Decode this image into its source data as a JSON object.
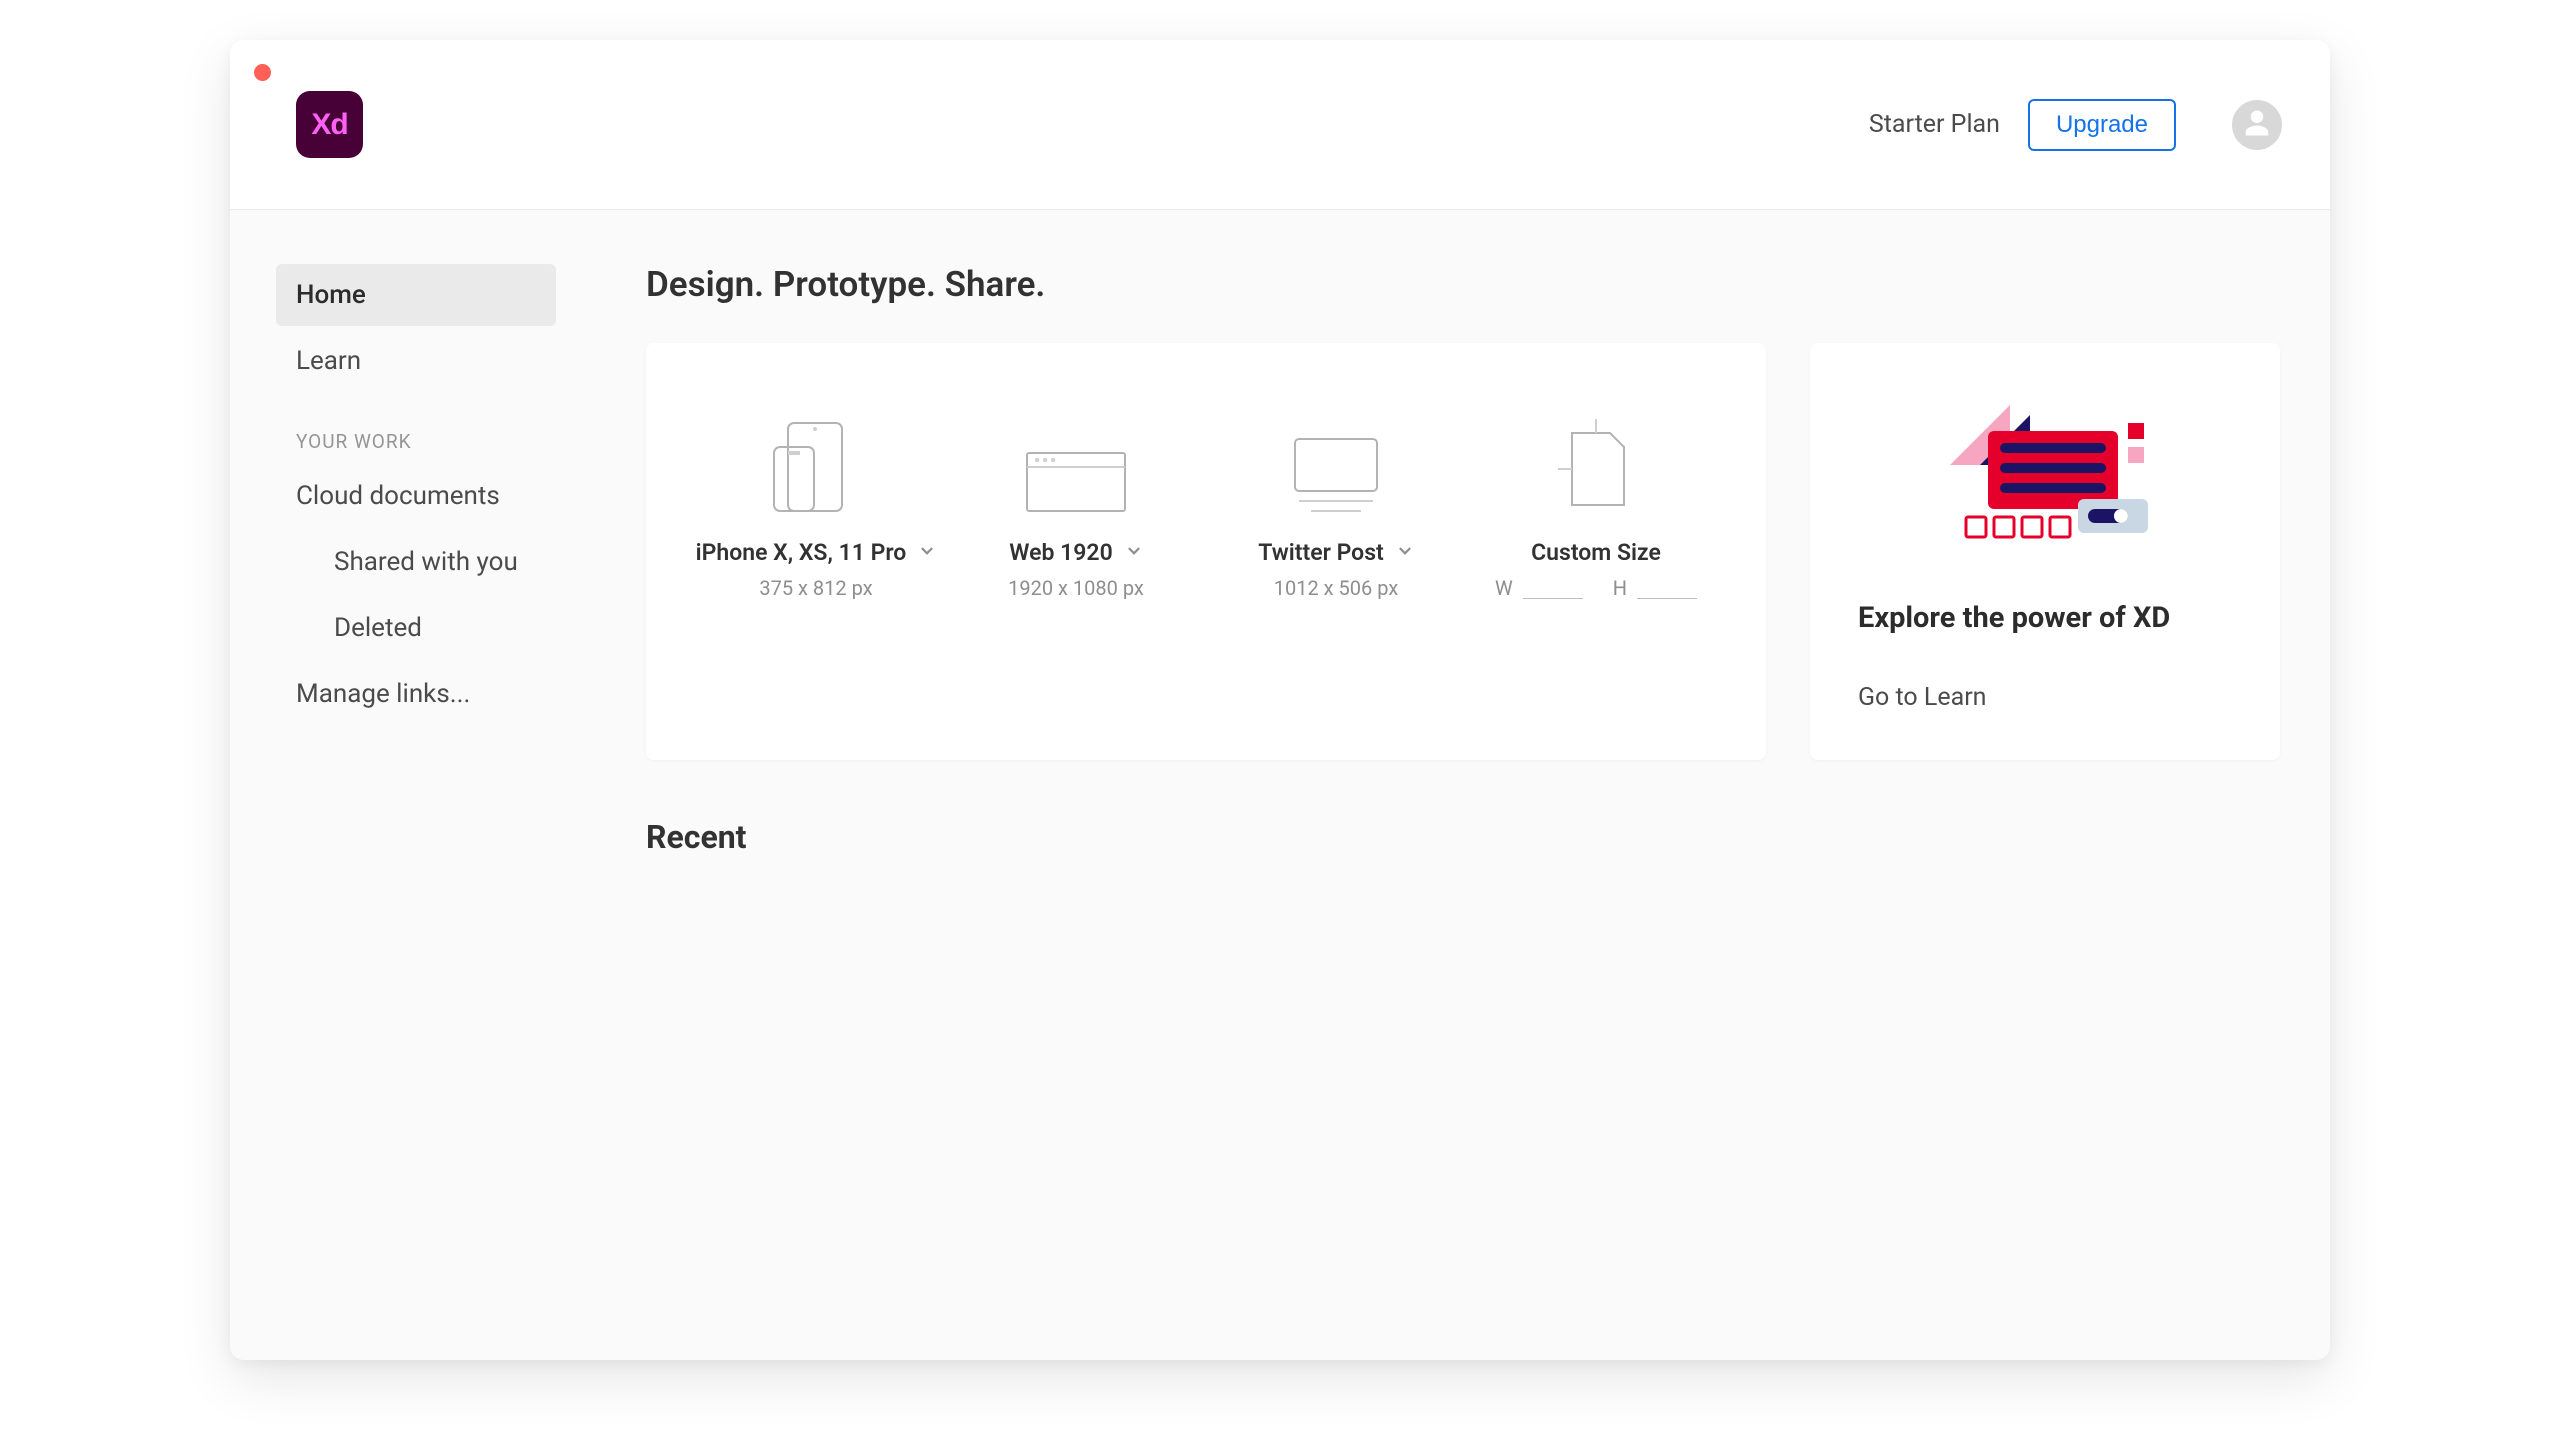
{
  "topbar": {
    "logo_text": "Xd",
    "plan_label": "Starter Plan",
    "upgrade_label": "Upgrade"
  },
  "sidebar": {
    "home": "Home",
    "learn": "Learn",
    "section_label": "YOUR WORK",
    "cloud_docs": "Cloud documents",
    "shared": "Shared with you",
    "deleted": "Deleted",
    "manage_links": "Manage links..."
  },
  "main": {
    "headline": "Design. Prototype. Share.",
    "recent_heading": "Recent"
  },
  "presets": {
    "iphone": {
      "title": "iPhone X, XS, 11 Pro",
      "sub": "375 x 812 px"
    },
    "web": {
      "title": "Web 1920",
      "sub": "1920 x 1080 px"
    },
    "twitter": {
      "title": "Twitter Post",
      "sub": "1012 x 506 px"
    },
    "custom": {
      "title": "Custom Size",
      "w_label": "W",
      "h_label": "H"
    }
  },
  "learn_card": {
    "title": "Explore the power of XD",
    "link": "Go to Learn"
  }
}
